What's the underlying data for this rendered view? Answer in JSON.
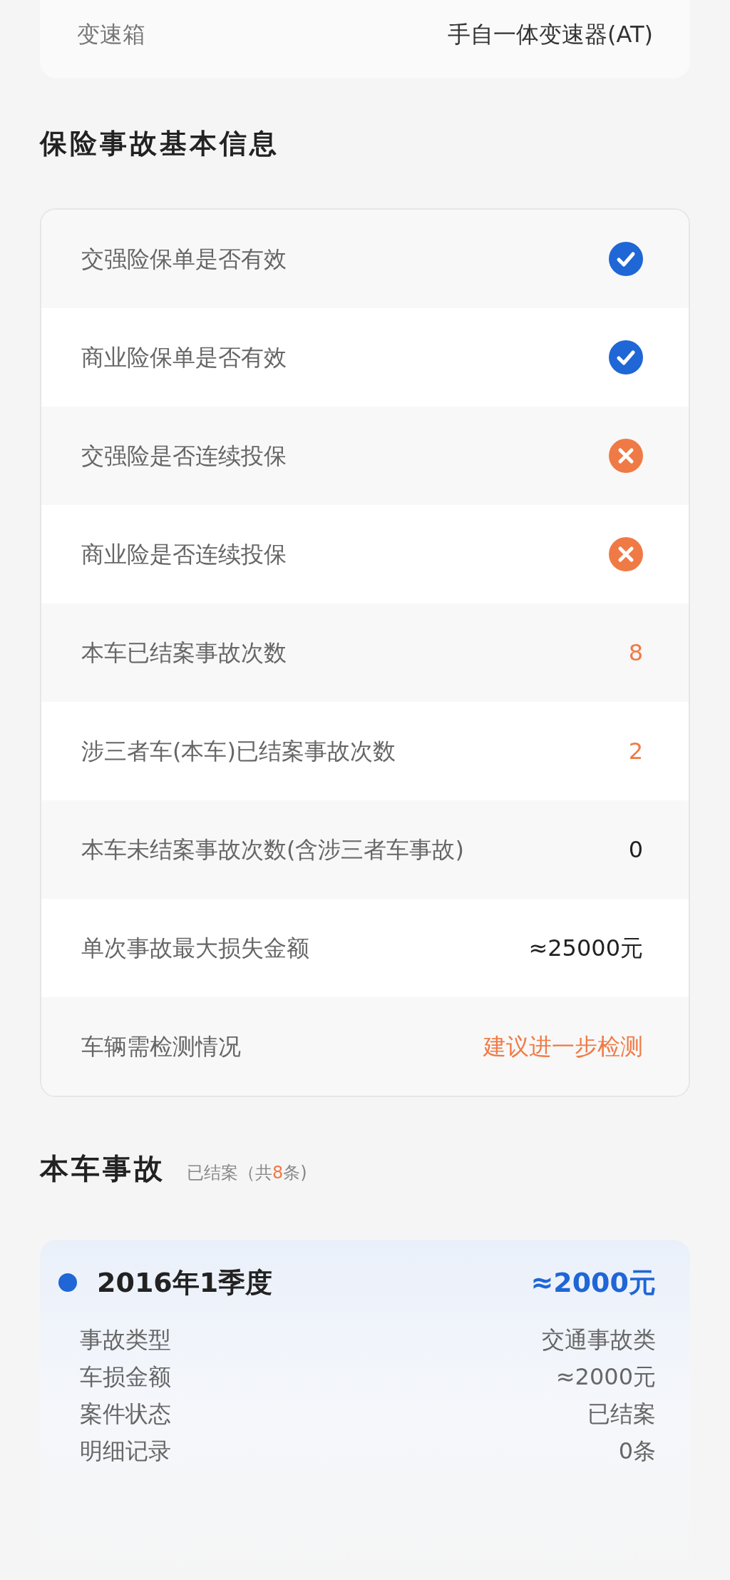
{
  "vehicle_info": [
    {
      "label": "变速箱",
      "value": "手自一体变速器(AT)"
    }
  ],
  "insurance_section": {
    "title": "保险事故基本信息",
    "rows": [
      {
        "kind": "status",
        "label": "交强险保单是否有效",
        "ok": true
      },
      {
        "kind": "status",
        "label": "商业险保单是否有效",
        "ok": true
      },
      {
        "kind": "status",
        "label": "交强险是否连续投保",
        "ok": false
      },
      {
        "kind": "status",
        "label": "商业险是否连续投保",
        "ok": false
      },
      {
        "kind": "value",
        "label": "本车已结案事故次数",
        "value": "8",
        "alert": true
      },
      {
        "kind": "value",
        "label": "涉三者车(本车)已结案事故次数",
        "value": "2",
        "alert": true
      },
      {
        "kind": "value",
        "label": "本车未结案事故次数(含涉三者车事故)",
        "value": "0",
        "alert": false
      },
      {
        "kind": "value",
        "label": "单次事故最大损失金额",
        "value": "≈25000元",
        "alert": false
      },
      {
        "kind": "value",
        "label": "车辆需检测情况",
        "value": "建议进一步检测",
        "alert": true
      }
    ]
  },
  "accidents_section": {
    "title": "本车事故",
    "subtitle_prefix": "已结案（共",
    "count": "8",
    "subtitle_suffix": "条)",
    "records": [
      {
        "period": "2016年1季度",
        "amount": "≈2000元",
        "details": [
          {
            "label": "事故类型",
            "value": "交通事故类"
          },
          {
            "label": "车损金额",
            "value": "≈2000元"
          },
          {
            "label": "案件状态",
            "value": "已结案"
          },
          {
            "label": "明细记录",
            "value": "0条"
          }
        ]
      }
    ]
  }
}
